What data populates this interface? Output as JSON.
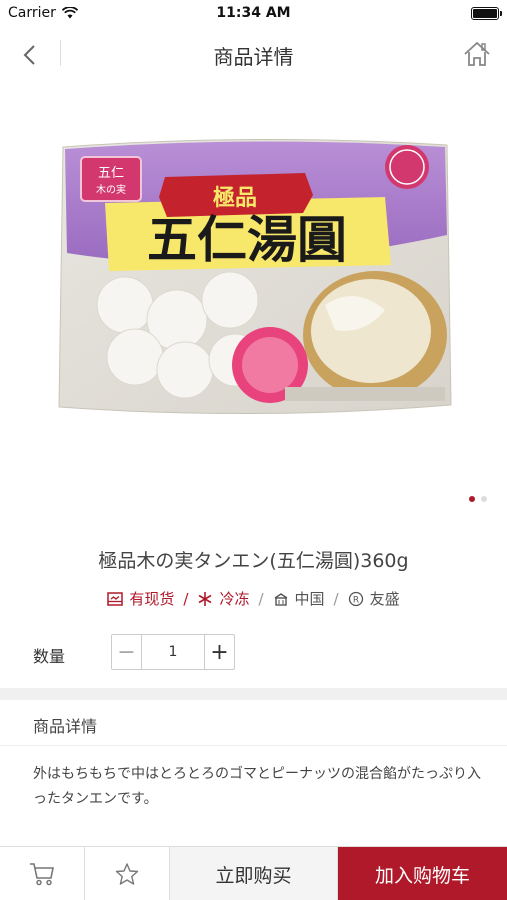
{
  "status_bar": {
    "carrier": "Carrier",
    "time": "11:34 AM"
  },
  "nav": {
    "title": "商品详情",
    "back_icon": "chevron-left-icon",
    "home_icon": "home-icon"
  },
  "product": {
    "package_text": {
      "brand_small": "五仁",
      "brand_small_sub": "木の実",
      "grade": "極品",
      "name": "五仁湯圓"
    },
    "carousel": {
      "count": 2,
      "active": 1
    },
    "title": "極品木の実タンエン(五仁湯圓)360g",
    "tags": [
      {
        "icon": "stock-icon",
        "label": "有现货",
        "color": "#b0192a"
      },
      {
        "icon": "snowflake-icon",
        "label": "冷冻",
        "color": "#b0192a"
      },
      {
        "icon": "origin-icon",
        "label": "中国",
        "color": "#555555"
      },
      {
        "icon": "registered-icon",
        "label": "友盛",
        "color": "#555555"
      }
    ]
  },
  "quantity": {
    "label": "数量",
    "value": "1",
    "minus": "−",
    "plus": "+"
  },
  "detail": {
    "header": "商品详情",
    "text": "外はもちもちで中はとろとろのゴマとピーナッツの混合餡がたっぷり入ったタンエンです。"
  },
  "bottom_bar": {
    "cart_icon": "cart-icon",
    "favorite_icon": "star-icon",
    "buy_now": "立即购买",
    "add_to_cart": "加入购物车"
  },
  "colors": {
    "accent": "#b0192a",
    "package_purple": "#a77bc8"
  }
}
